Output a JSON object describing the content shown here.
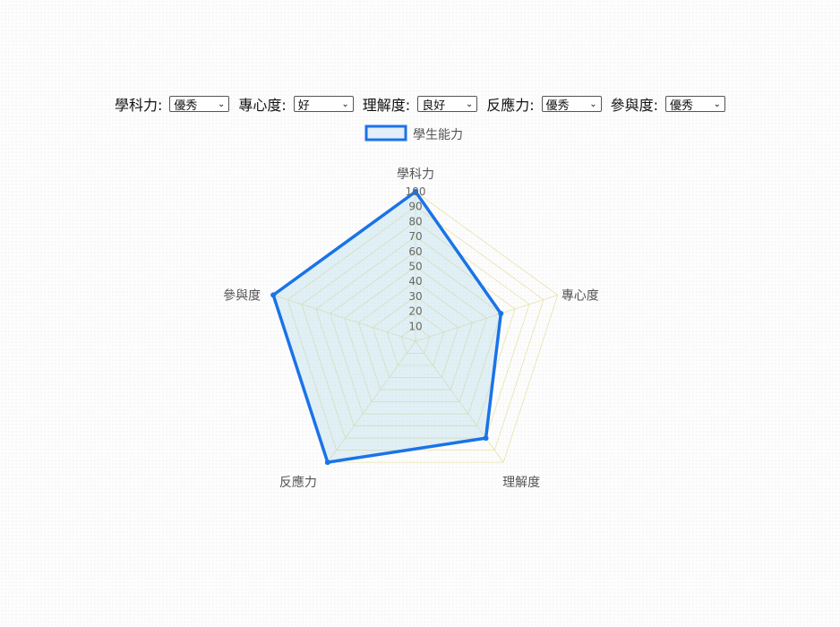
{
  "controls": [
    {
      "label": "學科力:",
      "value": "優秀"
    },
    {
      "label": "專心度:",
      "value": "好"
    },
    {
      "label": "理解度:",
      "value": "良好"
    },
    {
      "label": "反應力:",
      "value": "優秀"
    },
    {
      "label": "參與度:",
      "value": "優秀"
    }
  ],
  "chart_data": {
    "type": "radar",
    "categories": [
      "學科力",
      "專心度",
      "理解度",
      "反應力",
      "參與度"
    ],
    "series": [
      {
        "name": "學生能力",
        "values": [
          100,
          60,
          80,
          100,
          100
        ],
        "color": "#1a73e8",
        "fill": "rgba(173,216,230,0.35)"
      }
    ],
    "rlim": [
      0,
      100
    ],
    "ticks": [
      "10",
      "20",
      "30",
      "40",
      "50",
      "60",
      "70",
      "80",
      "90",
      "100"
    ],
    "legend": "top",
    "grid": true,
    "grid_color": "#e8e2a8"
  }
}
